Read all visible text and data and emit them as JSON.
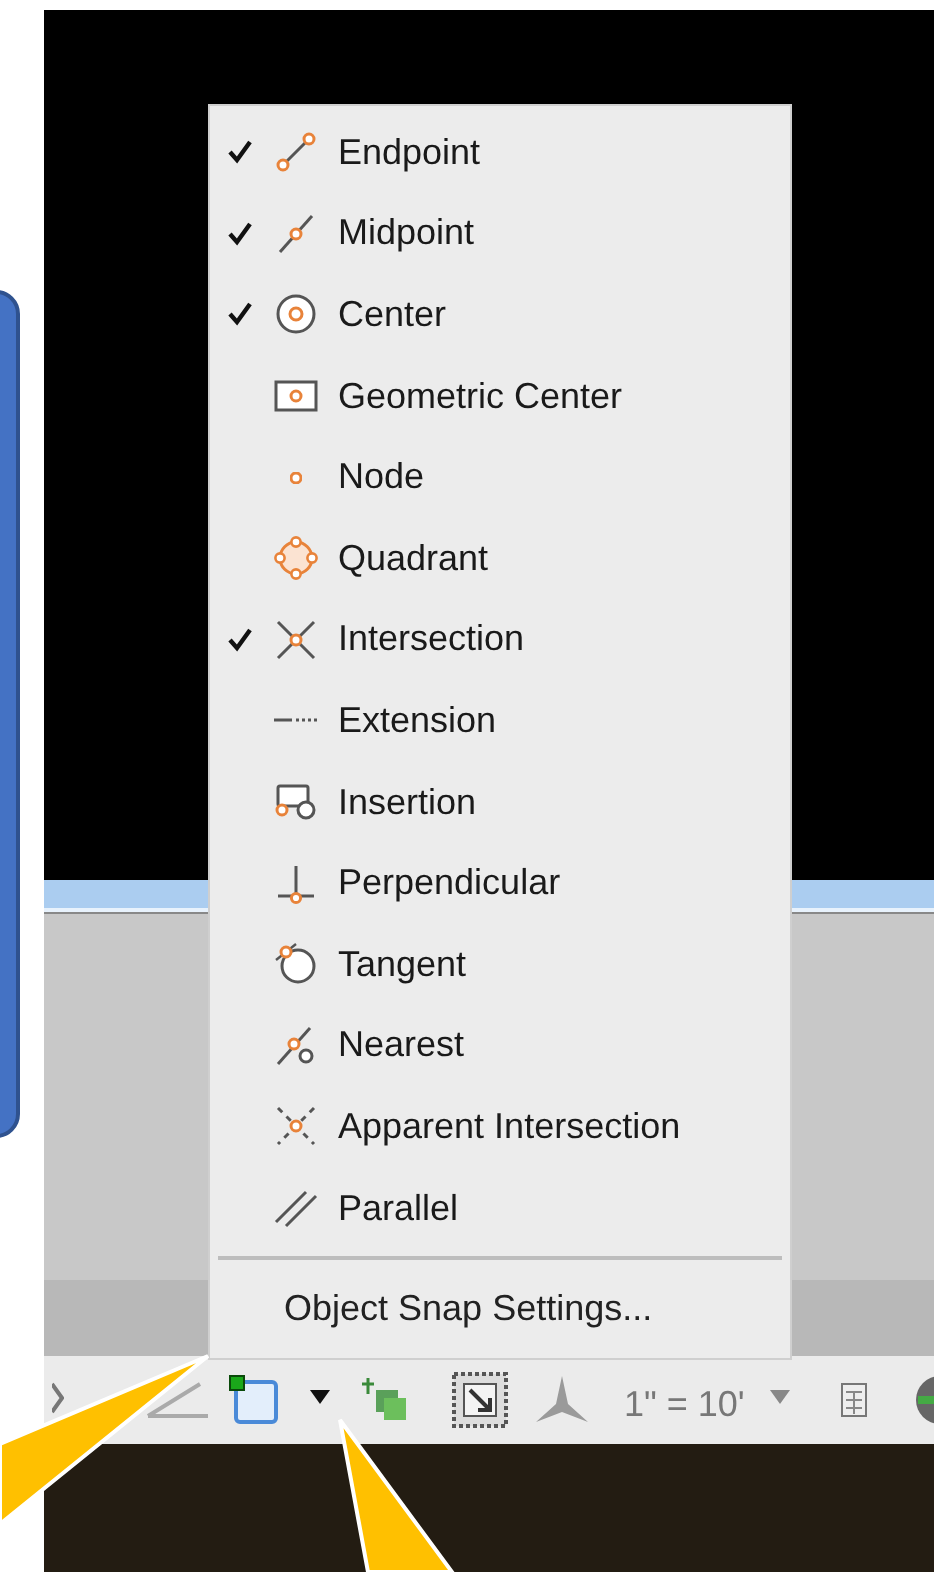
{
  "snap_menu": {
    "items": [
      {
        "label": "Endpoint",
        "checked": true
      },
      {
        "label": "Midpoint",
        "checked": true
      },
      {
        "label": "Center",
        "checked": true
      },
      {
        "label": "Geometric Center",
        "checked": false
      },
      {
        "label": "Node",
        "checked": false
      },
      {
        "label": "Quadrant",
        "checked": false
      },
      {
        "label": "Intersection",
        "checked": true
      },
      {
        "label": "Extension",
        "checked": false
      },
      {
        "label": "Insertion",
        "checked": false
      },
      {
        "label": "Perpendicular",
        "checked": false
      },
      {
        "label": "Tangent",
        "checked": false
      },
      {
        "label": "Nearest",
        "checked": false
      },
      {
        "label": "Apparent Intersection",
        "checked": false
      },
      {
        "label": "Parallel",
        "checked": false
      }
    ],
    "settings": "Object Snap Settings..."
  },
  "status_bar": {
    "scale": "1\" = 10'"
  }
}
